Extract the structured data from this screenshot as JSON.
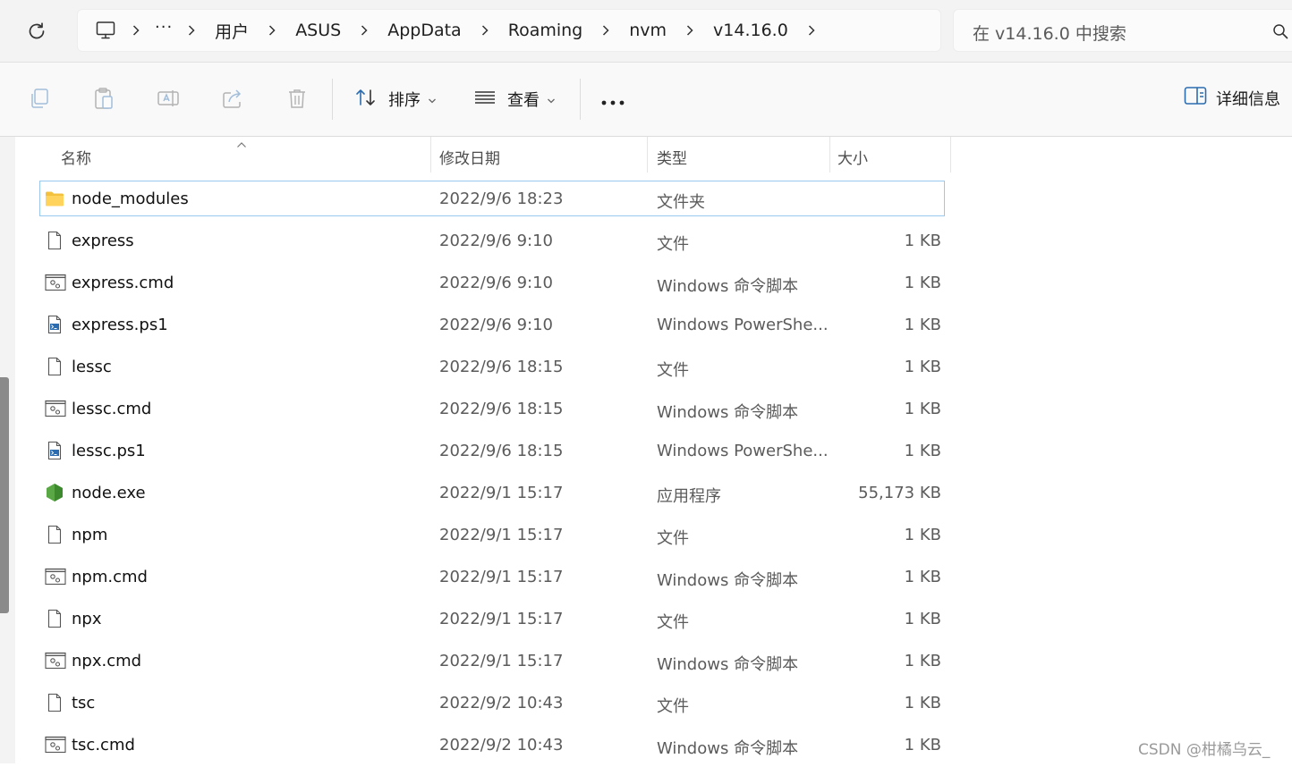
{
  "address": {
    "breadcrumbs": [
      "用户",
      "ASUS",
      "AppData",
      "Roaming",
      "nvm",
      "v14.16.0"
    ],
    "overflow": "···"
  },
  "search": {
    "placeholder": "在 v14.16.0 中搜索"
  },
  "toolbar": {
    "sort_label": "排序",
    "view_label": "查看",
    "more_label": "···",
    "details_label": "详细信息"
  },
  "columns": {
    "name": "名称",
    "modified": "修改日期",
    "type": "类型",
    "size": "大小"
  },
  "files": [
    {
      "name": "node_modules",
      "date": "2022/9/6 18:23",
      "type": "文件夹",
      "size": "",
      "icon": "folder-icon"
    },
    {
      "name": "express",
      "date": "2022/9/6 9:10",
      "type": "文件",
      "size": "1 KB",
      "icon": "file-icon"
    },
    {
      "name": "express.cmd",
      "date": "2022/9/6 9:10",
      "type": "Windows 命令脚本",
      "size": "1 KB",
      "icon": "cmd-script-icon"
    },
    {
      "name": "express.ps1",
      "date": "2022/9/6 9:10",
      "type": "Windows PowerShe...",
      "size": "1 KB",
      "icon": "powershell-script-icon"
    },
    {
      "name": "lessc",
      "date": "2022/9/6 18:15",
      "type": "文件",
      "size": "1 KB",
      "icon": "file-icon"
    },
    {
      "name": "lessc.cmd",
      "date": "2022/9/6 18:15",
      "type": "Windows 命令脚本",
      "size": "1 KB",
      "icon": "cmd-script-icon"
    },
    {
      "name": "lessc.ps1",
      "date": "2022/9/6 18:15",
      "type": "Windows PowerShe...",
      "size": "1 KB",
      "icon": "powershell-script-icon"
    },
    {
      "name": "node.exe",
      "date": "2022/9/1 15:17",
      "type": "应用程序",
      "size": "55,173 KB",
      "icon": "nodejs-icon"
    },
    {
      "name": "npm",
      "date": "2022/9/1 15:17",
      "type": "文件",
      "size": "1 KB",
      "icon": "file-icon"
    },
    {
      "name": "npm.cmd",
      "date": "2022/9/1 15:17",
      "type": "Windows 命令脚本",
      "size": "1 KB",
      "icon": "cmd-script-icon"
    },
    {
      "name": "npx",
      "date": "2022/9/1 15:17",
      "type": "文件",
      "size": "1 KB",
      "icon": "file-icon"
    },
    {
      "name": "npx.cmd",
      "date": "2022/9/1 15:17",
      "type": "Windows 命令脚本",
      "size": "1 KB",
      "icon": "cmd-script-icon"
    },
    {
      "name": "tsc",
      "date": "2022/9/2 10:43",
      "type": "文件",
      "size": "1 KB",
      "icon": "file-icon"
    },
    {
      "name": "tsc.cmd",
      "date": "2022/9/2 10:43",
      "type": "Windows 命令脚本",
      "size": "1 KB",
      "icon": "cmd-script-icon"
    }
  ],
  "watermark": "CSDN @柑橘乌云_"
}
